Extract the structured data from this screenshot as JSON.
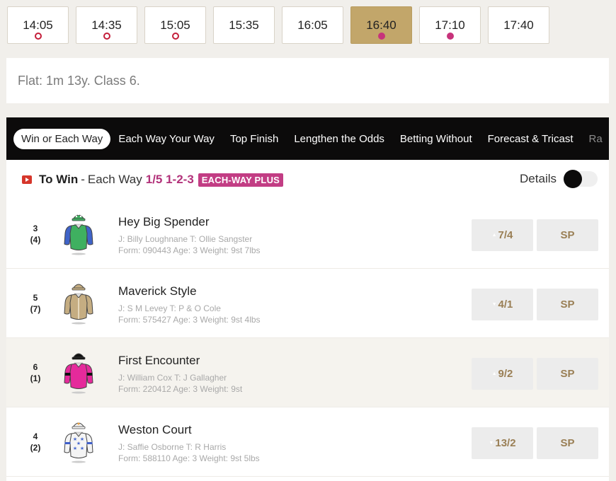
{
  "race_times": [
    {
      "time": "14:05",
      "indicator": "ring",
      "active": false
    },
    {
      "time": "14:35",
      "indicator": "ring",
      "active": false
    },
    {
      "time": "15:05",
      "indicator": "ring",
      "active": false
    },
    {
      "time": "15:35",
      "indicator": "none",
      "active": false
    },
    {
      "time": "16:05",
      "indicator": "none",
      "active": false
    },
    {
      "time": "16:40",
      "indicator": "fill",
      "active": true
    },
    {
      "time": "17:10",
      "indicator": "fill",
      "active": false
    },
    {
      "time": "17:40",
      "indicator": "none",
      "active": false
    }
  ],
  "race_info": "Flat: 1m 13y. Class 6.",
  "tabs": [
    {
      "label": "Win or Each Way",
      "active": true
    },
    {
      "label": "Each Way Your Way",
      "active": false
    },
    {
      "label": "Top Finish",
      "active": false
    },
    {
      "label": "Lengthen the Odds",
      "active": false
    },
    {
      "label": "Betting Without",
      "active": false
    },
    {
      "label": "Forecast & Tricast",
      "active": false
    },
    {
      "label": "Ra",
      "active": false
    }
  ],
  "market": {
    "title": "To Win",
    "dash": "-",
    "each_way": "Each Way",
    "terms": "1/5 1-2-3",
    "badge": "EACH-WAY PLUS",
    "details_label": "Details",
    "details_on": false
  },
  "colors": {
    "accent_gold": "#c2a66a",
    "odds_text": "#9a7f55",
    "each_way_pink": "#c23d84",
    "ring_red": "#c41e3a"
  },
  "runners": [
    {
      "number": "3",
      "draw": "(4)",
      "name": "Hey Big Spender",
      "jockey": "Billy Loughnane",
      "trainer": "Ollie Sangster",
      "form": "090443",
      "age": "3",
      "weight": "9st 7lbs",
      "odds": "7/4",
      "odds_trend": "up",
      "sp": "SP",
      "highlight": false,
      "silk": {
        "body": "#3fb060",
        "sleeves": "#3f63c8",
        "cap": "#3fb060",
        "pattern": "plain"
      }
    },
    {
      "number": "5",
      "draw": "(7)",
      "name": "Maverick Style",
      "jockey": "S M Levey",
      "trainer": "P & O Cole",
      "form": "575427",
      "age": "3",
      "weight": "9st 4lbs",
      "odds": "4/1",
      "odds_trend": "down",
      "sp": "SP",
      "highlight": false,
      "silk": {
        "body": "#c5ad82",
        "sleeves": "#c5ad82",
        "cap": "#c5ad82",
        "pattern": "seam"
      }
    },
    {
      "number": "6",
      "draw": "(1)",
      "name": "First Encounter",
      "jockey": "William Cox",
      "trainer": "J Gallagher",
      "form": "220412",
      "age": "3",
      "weight": "9st",
      "odds": "9/2",
      "odds_trend": "up",
      "sp": "SP",
      "highlight": true,
      "silk": {
        "body": "#e52a9b",
        "sleeves": "#e52a9b",
        "cap": "#111111",
        "pattern": "armbands"
      }
    },
    {
      "number": "4",
      "draw": "(2)",
      "name": "Weston Court",
      "jockey": "Saffie Osborne",
      "trainer": "R Harris",
      "form": "588110",
      "age": "3",
      "weight": "9st 5lbs",
      "odds": "13/2",
      "odds_trend": "down",
      "sp": "SP",
      "highlight": false,
      "silk": {
        "body": "#f4f4f4",
        "sleeves": "#f4f4f4",
        "cap": "#f4f4f4",
        "pattern": "stars"
      }
    }
  ],
  "labels": {
    "jockey_prefix": "J:",
    "trainer_prefix": "T:",
    "form_prefix": "Form:",
    "age_prefix": "Age:",
    "weight_prefix": "Weight:"
  }
}
